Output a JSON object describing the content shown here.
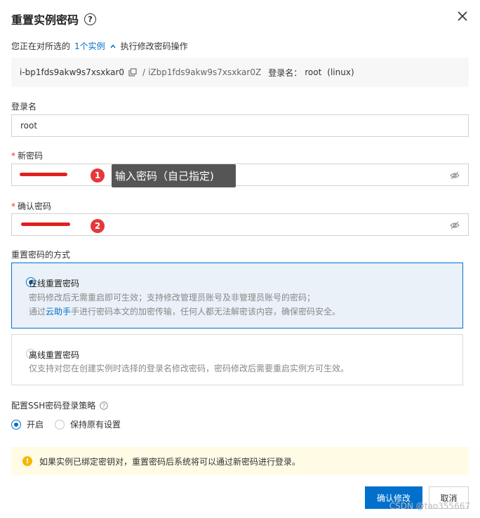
{
  "dialog": {
    "title": "重置实例密码",
    "help_icon": "question-circle-icon",
    "close_icon": "close-icon"
  },
  "instance_line": {
    "prefix": "您正在对所选的",
    "link": "1个实例",
    "suffix": "执行修改密码操作"
  },
  "instance_info": {
    "id": "i-bp1fds9akw9s7xsxkar0",
    "separator": "/",
    "host": "iZbp1fds9akw9s7xsxkar0Z",
    "login_label": "登录名：",
    "login_value": "root",
    "os": "(linux)"
  },
  "fields": {
    "login_name_label": "登录名",
    "login_name_value": "root",
    "new_password_label": "新密码",
    "confirm_password_label": "确认密码"
  },
  "annotations": {
    "badge1": "1",
    "badge2": "2",
    "tooltip": "输入密码（自己指定)",
    "line_color": "#e02020"
  },
  "reset_method": {
    "label": "重置密码的方式",
    "online": {
      "title": "在线重置密码",
      "desc1": "密码修改后无需重启即可生效；支持修改管理员账号及非管理员账号的密码；",
      "desc2_pre": "通过",
      "desc2_link": "云助手",
      "desc2_post": "手进行密码本文的加密传输，任何人都无法解密该内容，确保密码安全。",
      "selected": true
    },
    "offline": {
      "title": "离线重置密码",
      "desc": "仅支持对您在创建实例时选择的登录名修改密码，密码修改后需要重启实例方可生效。",
      "selected": false
    }
  },
  "ssh": {
    "label": "配置SSH密码登录策略",
    "options": [
      "开启",
      "保持原有设置"
    ],
    "selected_index": 0
  },
  "notice": {
    "text": "如果实例已绑定密钥对，重置密码后系统将可以通过新密码进行登录。"
  },
  "buttons": {
    "confirm": "确认修改",
    "cancel": "取消"
  },
  "watermark": "CSDN @tao355667",
  "colors": {
    "primary": "#0070cc",
    "required": "#e03636",
    "notice_bg": "#fffbe5"
  }
}
